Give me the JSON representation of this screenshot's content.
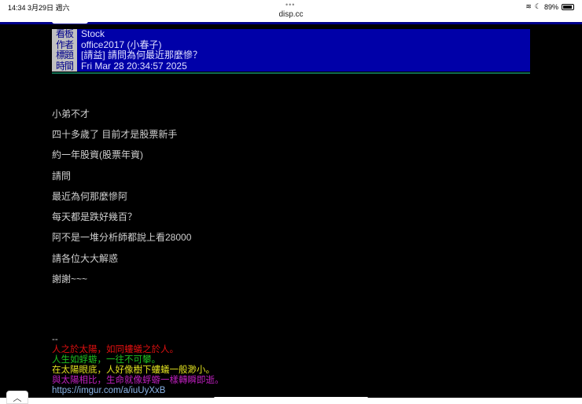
{
  "status_bar": {
    "time": "14:34  3月29日 週六",
    "dots": "•••",
    "url": "disp.cc",
    "battery": "89%",
    "battery_level": 0.89
  },
  "header": [
    {
      "label": "看板",
      "value": "Stock"
    },
    {
      "label": "作者",
      "value": "office2017 (小春子)"
    },
    {
      "label": "標題",
      "value": "[請益] 請問為何最近那麼慘？"
    },
    {
      "label": "時間",
      "value": "Fri Mar 28 20:34:57 2025"
    }
  ],
  "body": [
    "小弟不才",
    "四十多歲了 目前才是股票新手",
    "約一年股資(股票年資)",
    "請問",
    "最近為何那麼慘阿",
    "每天都是跌好幾百？",
    "阿不是一堆分析師都說上看28000",
    "請各位大大解惑",
    "謝謝~~~"
  ],
  "signature": {
    "separator": "--",
    "lines": [
      {
        "text": "人之於太陽，如同螻蟻之於人。",
        "color": "#e01010"
      },
      {
        "text": "人生如蜉蝣，一往不可攀。",
        "color": "#20c020"
      },
      {
        "text": "在太陽眼底，人好像樹下螻蟻一般渺小。",
        "color": "#e0e020"
      },
      {
        "text": "與太陽相比，生命就像蜉蝣一樣轉瞬即逝。",
        "color": "#c020c0"
      }
    ],
    "link": "https://imgur.com/a/iuUyXxB"
  },
  "controls": {
    "scroll_up": "︿"
  }
}
